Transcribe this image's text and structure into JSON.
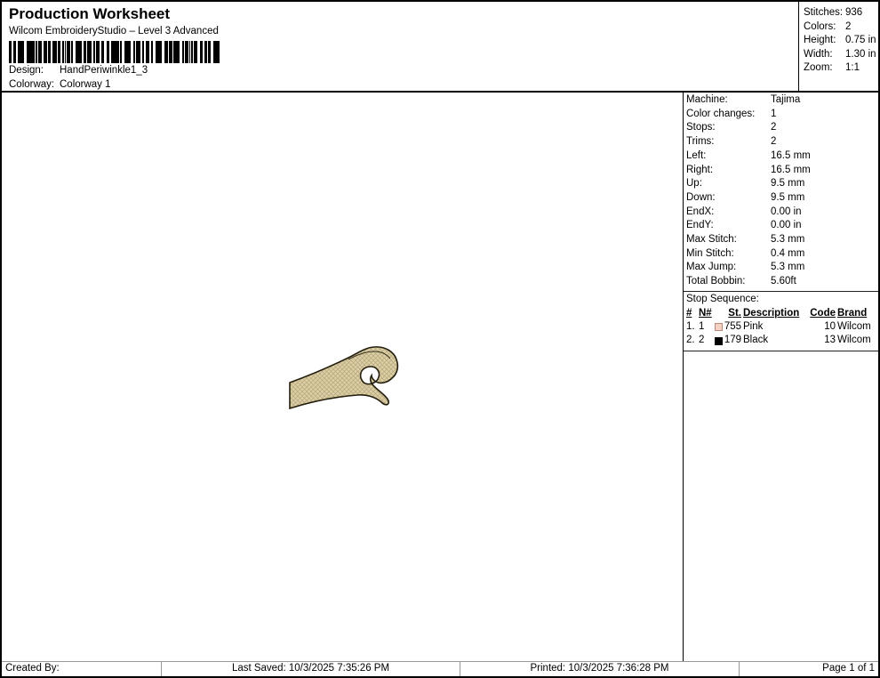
{
  "header": {
    "title": "Production Worksheet",
    "subtitle": "Wilcom EmbroideryStudio – Level 3 Advanced",
    "design_label": "Design:",
    "design_value": "HandPeriwinkle1_3",
    "colorway_label": "Colorway:",
    "colorway_value": "Colorway 1"
  },
  "summary": {
    "rows": [
      {
        "label": "Stitches:",
        "value": "936"
      },
      {
        "label": "Colors:",
        "value": "2"
      },
      {
        "label": "Height:",
        "value": "0.75 in"
      },
      {
        "label": "Width:",
        "value": "1.30 in"
      },
      {
        "label": "Zoom:",
        "value": "1:1"
      }
    ]
  },
  "machine_panel": {
    "rows": [
      {
        "label": "Machine:",
        "value": "Tajima"
      },
      {
        "label": "Color changes:",
        "value": "1"
      },
      {
        "label": "Stops:",
        "value": "2"
      },
      {
        "label": "Trims:",
        "value": "2"
      },
      {
        "label": "Left:",
        "value": "16.5 mm"
      },
      {
        "label": "Right:",
        "value": "16.5 mm"
      },
      {
        "label": "Up:",
        "value": "9.5 mm"
      },
      {
        "label": "Down:",
        "value": "9.5 mm"
      },
      {
        "label": "EndX:",
        "value": "0.00 in"
      },
      {
        "label": "EndY:",
        "value": "0.00 in"
      },
      {
        "label": "Max Stitch:",
        "value": "5.3 mm"
      },
      {
        "label": "Min Stitch:",
        "value": "0.4 mm"
      },
      {
        "label": "Max Jump:",
        "value": "5.3 mm"
      },
      {
        "label": "Total Bobbin:",
        "value": "5.60ft"
      }
    ],
    "stop_sequence_label": "Stop Sequence:",
    "table": {
      "headers": [
        "#",
        "N#",
        "St.",
        "Description",
        "Code",
        "Brand"
      ],
      "rows": [
        {
          "num": "1.",
          "n": "1",
          "swatch_color": "#f3d2c4",
          "swatch_border": "#b98b7c",
          "st": "755",
          "description": "Pink",
          "code": "10",
          "brand": "Wilcom"
        },
        {
          "num": "2.",
          "n": "2",
          "swatch_color": "#000000",
          "swatch_border": "#000000",
          "st": "179",
          "description": "Black",
          "code": "13",
          "brand": "Wilcom"
        }
      ]
    }
  },
  "design_preview": {
    "name": "hand embroidery design",
    "fill_color": "#dccfa6",
    "stitch_color": "#b5a67c",
    "outline_color": "#241e0e"
  },
  "footer": {
    "created_by": "Created By:",
    "last_saved": "Last Saved: 10/3/2025 7:35:26 PM",
    "printed": "Printed: 10/3/2025 7:36:28 PM",
    "page": "Page 1 of 1"
  }
}
